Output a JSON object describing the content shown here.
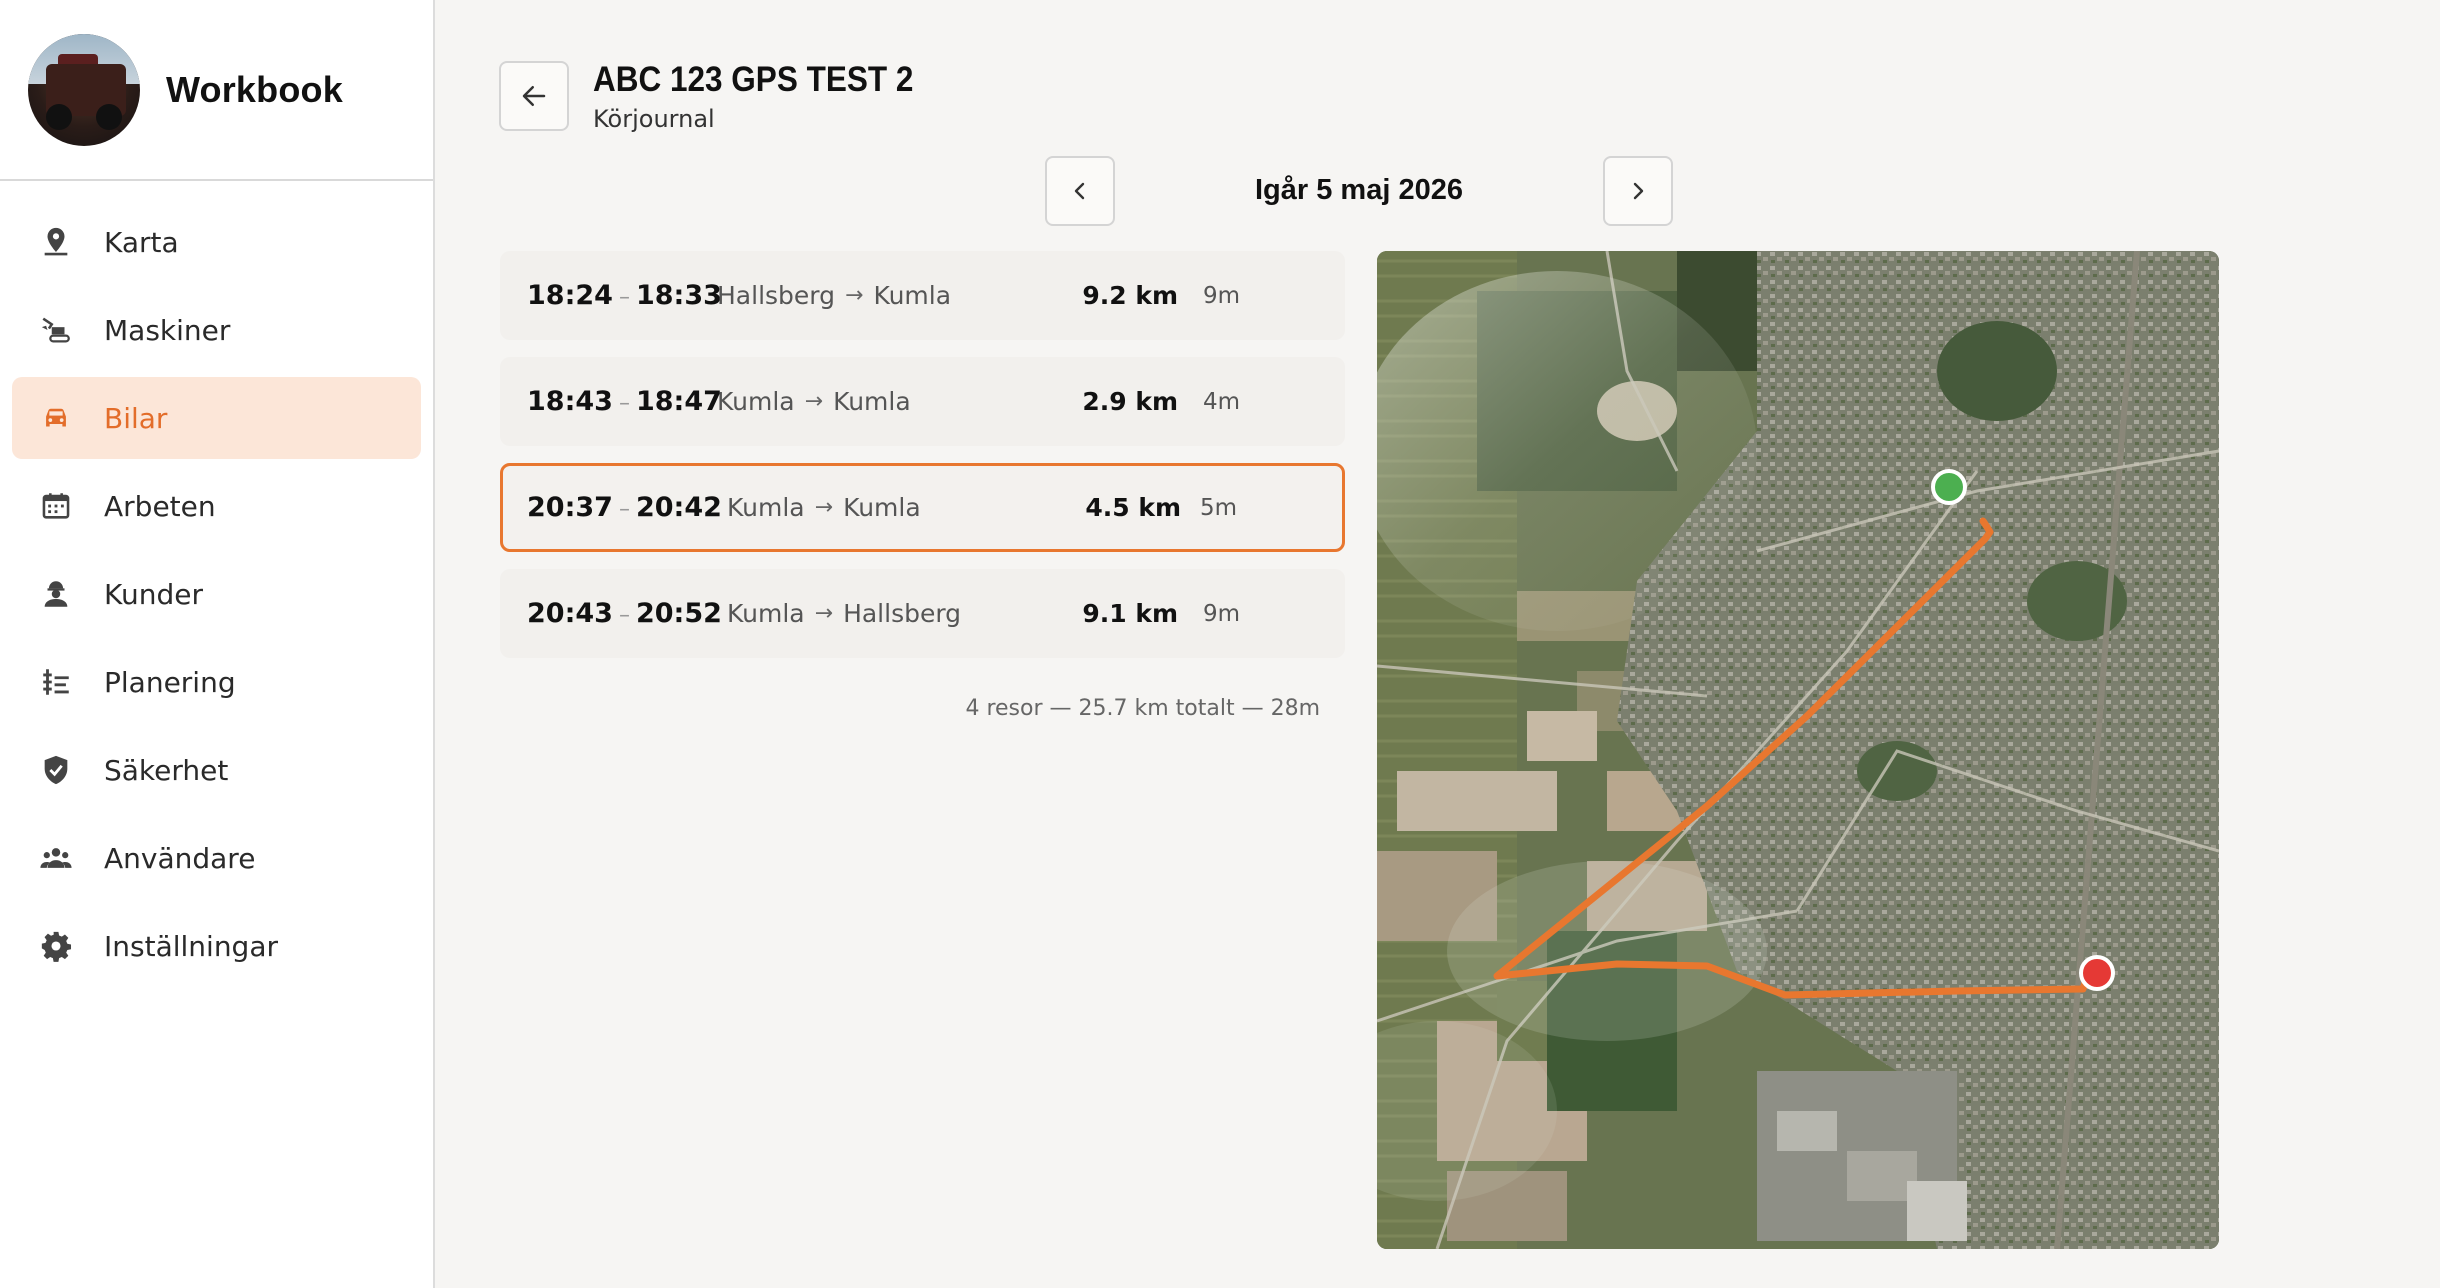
{
  "sidebar": {
    "brand_name": "Workbook",
    "items": [
      {
        "label": "Karta",
        "icon": "map-pin-icon",
        "active": false
      },
      {
        "label": "Maskiner",
        "icon": "excavator-icon",
        "active": false
      },
      {
        "label": "Bilar",
        "icon": "car-icon",
        "active": true
      },
      {
        "label": "Arbeten",
        "icon": "calendar-icon",
        "active": false
      },
      {
        "label": "Kunder",
        "icon": "worker-icon",
        "active": false
      },
      {
        "label": "Planering",
        "icon": "planning-icon",
        "active": false
      },
      {
        "label": "Säkerhet",
        "icon": "shield-check-icon",
        "active": false
      },
      {
        "label": "Användare",
        "icon": "users-icon",
        "active": false
      },
      {
        "label": "Inställningar",
        "icon": "gear-icon",
        "active": false
      }
    ]
  },
  "header": {
    "title": "ABC 123 GPS TEST 2",
    "subtitle": "Körjournal"
  },
  "date_nav": {
    "label": "Igår 5 maj 2026"
  },
  "trips": [
    {
      "start": "18:24",
      "end": "18:33",
      "from": "Hallsberg",
      "to": "Kumla",
      "distance": "9.2 km",
      "duration": "9m",
      "selected": false
    },
    {
      "start": "18:43",
      "end": "18:47",
      "from": "Kumla",
      "to": "Kumla",
      "distance": "2.9 km",
      "duration": "4m",
      "selected": false
    },
    {
      "start": "20:37",
      "end": "20:42",
      "from": "Kumla",
      "to": "Kumla",
      "distance": "4.5 km",
      "duration": "5m",
      "selected": true
    },
    {
      "start": "20:43",
      "end": "20:52",
      "from": "Kumla",
      "to": "Hallsberg",
      "distance": "9.1 km",
      "duration": "9m",
      "selected": false
    }
  ],
  "summary": "4 resor — 25.7 km totalt — 28m",
  "colors": {
    "accent": "#e36d2a",
    "route": "#e8772f",
    "start_marker": "#4caf50",
    "end_marker": "#e53935"
  }
}
